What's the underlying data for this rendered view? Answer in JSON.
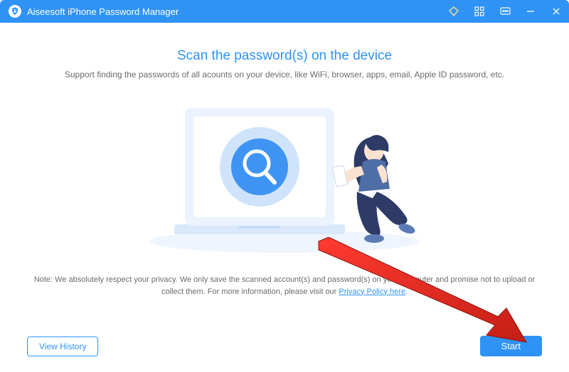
{
  "titlebar": {
    "app_title": "Aiseesoft iPhone Password Manager"
  },
  "main": {
    "headline": "Scan the password(s) on the device",
    "subhead": "Support finding the passwords of all acounts on your device, like  WiFi, browser, apps, email, Apple ID password, etc.",
    "note_prefix": "Note: We absolutely respect your privacy. We only save the scanned account(s) and password(s) on your computer and promise not to upload or collect them. For more information, please visit our ",
    "privacy_link_label": "Privacy Policy here",
    "note_suffix": "."
  },
  "footer": {
    "view_history_label": "View History",
    "start_label": "Start"
  },
  "colors": {
    "accent": "#2f93f6"
  }
}
